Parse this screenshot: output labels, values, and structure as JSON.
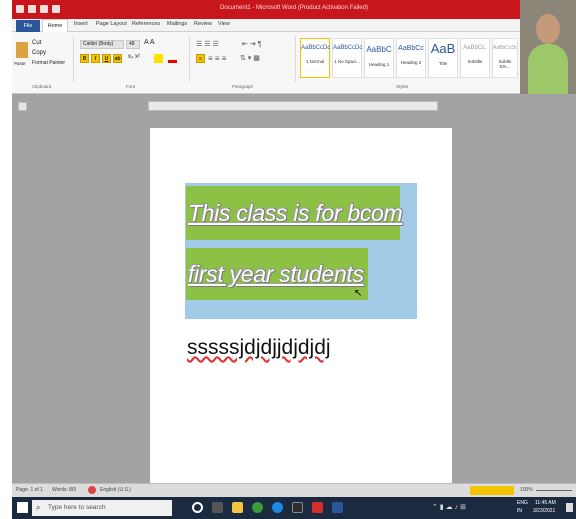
{
  "titlebar": {
    "title": "Document1 - Microsoft Word (Product Activation Failed)"
  },
  "tabs": [
    "File",
    "Home",
    "Insert",
    "Page Layout",
    "References",
    "Mailings",
    "Review",
    "View"
  ],
  "clipboard": {
    "cut": "Cut",
    "copy": "Copy",
    "paste": "Paste",
    "format_painter": "Format Painter",
    "label": "Clipboard"
  },
  "font": {
    "name": "Calibri (Body)",
    "size": "48",
    "label": "Font"
  },
  "paragraph": {
    "label": "Paragraph"
  },
  "styles": {
    "items": [
      {
        "preview": "AaBbCcDc",
        "name": "1 Normal"
      },
      {
        "preview": "AaBbCcDc",
        "name": "1 No Spaci..."
      },
      {
        "preview": "AaBbC",
        "name": "Heading 1"
      },
      {
        "preview": "AaBbCc",
        "name": "Heading 2"
      },
      {
        "preview": "AaB",
        "name": "Title"
      },
      {
        "preview": "AaBbCc.",
        "name": "Subtitle"
      },
      {
        "preview": "AaBbCcDc",
        "name": "Subtle Em..."
      }
    ],
    "label": "Styles"
  },
  "document": {
    "line1": "This class is for bcom",
    "line2": "first year students",
    "line3": "sssssjdjdjjdjdjdj"
  },
  "status": {
    "page": "Page: 1 of 1",
    "words": "Words: 8/9",
    "language": "English (U.S.)",
    "zoom": "100%"
  },
  "taskbar": {
    "search_placeholder": "Type here to search",
    "lang": "ENG",
    "region": "IN",
    "time": "11:45 AM",
    "date": "3/23/2021"
  },
  "colors": {
    "word_red": "#c8161d",
    "highlight_green": "#8cc146",
    "selection_blue": "#a3cae6",
    "file_tab": "#2b579a"
  }
}
